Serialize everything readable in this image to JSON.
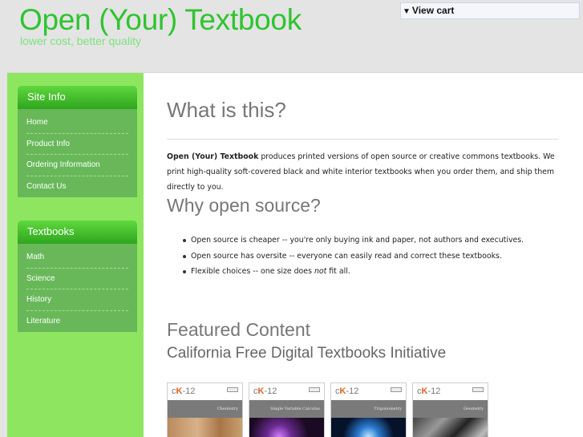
{
  "header": {
    "title": "Open (Your) Textbook",
    "tagline": "lower cost, better quality",
    "cart_label": "View cart"
  },
  "sidebar": {
    "site_info": {
      "title": "Site Info",
      "items": [
        "Home",
        "Product Info",
        "Ordering Information",
        "Contact Us"
      ]
    },
    "textbooks": {
      "title": "Textbooks",
      "items": [
        "Math",
        "Science",
        "History",
        "Literature"
      ]
    }
  },
  "main": {
    "what_title": "What is this?",
    "intro_bold": "Open (Your) Textbook",
    "intro_text": " produces printed versions of open source or creative commons textbooks. We print high-quality soft-covered black and white interior textbooks when you order them, and ship them directly to you.",
    "why_title": "Why open source?",
    "bullets": {
      "b1": "Open source is cheaper -- you're only buying ink and paper, not authors and executives.",
      "b2": "Open source has oversite -- everyone can easily read and correct these textbooks.",
      "b3_pre": "Flexible choices -- one size does ",
      "b3_em": "not",
      "b3_post": " fit all."
    },
    "featured_title": "Featured Content",
    "featured_subtitle": "California Free Digital Textbooks Initiative",
    "covers": [
      {
        "logo_c": "c",
        "logo_k": "K",
        "logo_rest": "-12",
        "band": "Chemistry"
      },
      {
        "logo_c": "c",
        "logo_k": "K",
        "logo_rest": "-12",
        "band": "Single Variable Calculus"
      },
      {
        "logo_c": "c",
        "logo_k": "K",
        "logo_rest": "-12",
        "band": "Trigonometry"
      },
      {
        "logo_c": "c",
        "logo_k": "K",
        "logo_rest": "-12",
        "band": "Geometry"
      }
    ]
  },
  "colors": {
    "brand_green": "#2fc42f",
    "sidebar_green": "#8ee660",
    "box_body": "#68b85a"
  }
}
